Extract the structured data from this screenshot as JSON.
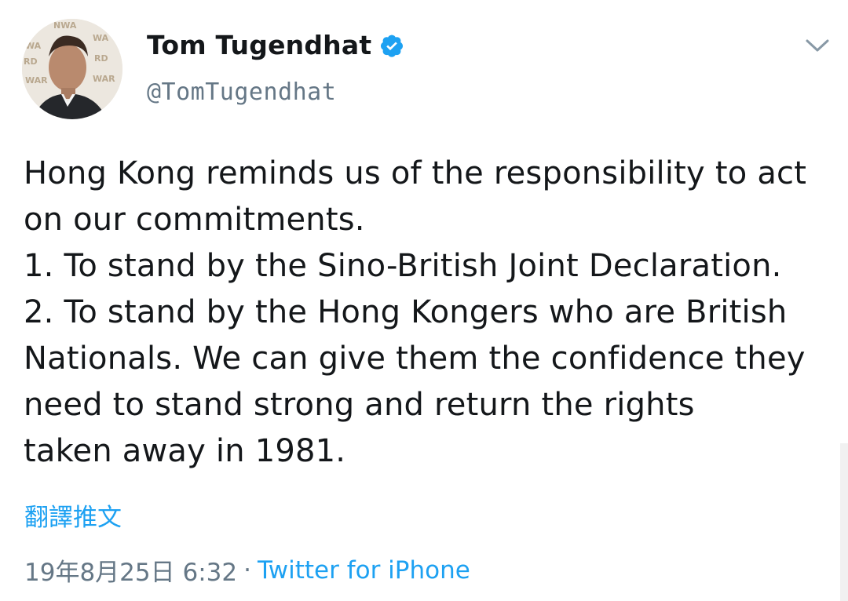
{
  "author": {
    "display_name": "Tom Tugendhat",
    "handle": "@TomTugendhat",
    "verified": true,
    "avatar_icon": "profile-photo",
    "verified_icon": "verified-badge-icon"
  },
  "tweet": {
    "lines": [
      "Hong Kong reminds us of the responsibility to act",
      "on our commitments.",
      "1. To stand by the Sino-British Joint Declaration.",
      "2. To stand by the Hong Kongers who are British",
      "Nationals. We can give them the confidence they",
      "need to stand strong and return the rights",
      "taken away in 1981."
    ],
    "translate_label": "翻譯推文",
    "timestamp": "19年8月25日 6:32",
    "separator": "·",
    "source": "Twitter for iPhone"
  },
  "menu": {
    "caret_icon": "chevron-down-icon"
  },
  "colors": {
    "accent": "#1da1f2",
    "text": "#14171a",
    "secondary": "#657786"
  }
}
